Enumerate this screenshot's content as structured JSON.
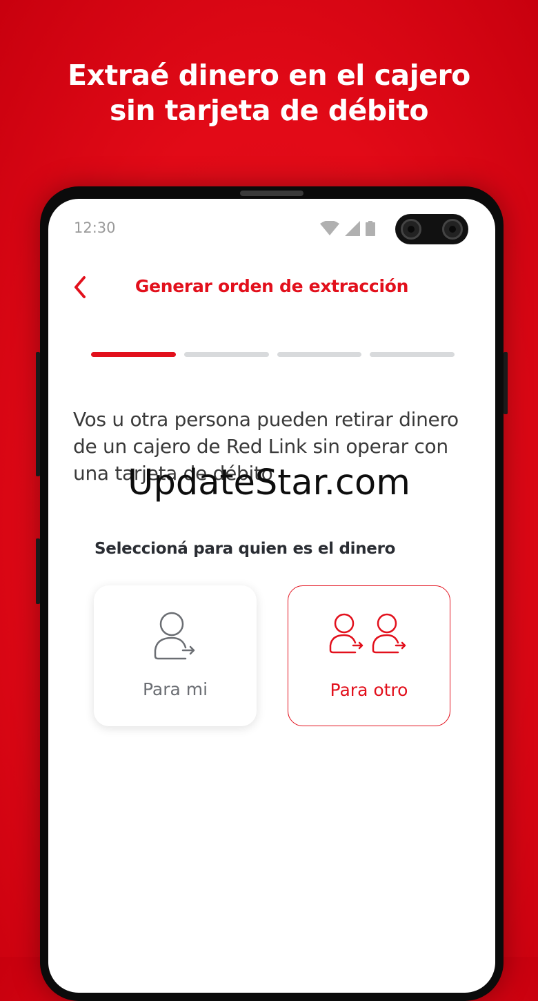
{
  "promo": {
    "headline_line1": "Extraé dinero en el cajero",
    "headline_line2": "sin tarjeta de débito"
  },
  "status_bar": {
    "time": "12:30",
    "icons": [
      "wifi-icon",
      "signal-icon",
      "battery-icon"
    ]
  },
  "header": {
    "title": "Generar orden de extracción",
    "back_icon": "chevron-left-icon"
  },
  "progress": {
    "total_steps": 4,
    "current_step": 1
  },
  "main": {
    "description_line1": "Vos u otra persona pueden retirar dinero",
    "description_line2": "de un cajero de Red Link sin operar con",
    "description_line3": "una tarjeta de débito",
    "select_label": "Seleccioná para quien es el dinero",
    "options": [
      {
        "label": "Para mi",
        "icon": "person-arrow-icon",
        "selected": false
      },
      {
        "label": "Para otro",
        "icon": "two-persons-arrow-icon",
        "selected": true
      }
    ]
  },
  "watermark": "UpdateStar.com",
  "colors": {
    "brand_red": "#e2101c",
    "inactive_step": "#d8dadc",
    "background_red": "#d9101c"
  }
}
